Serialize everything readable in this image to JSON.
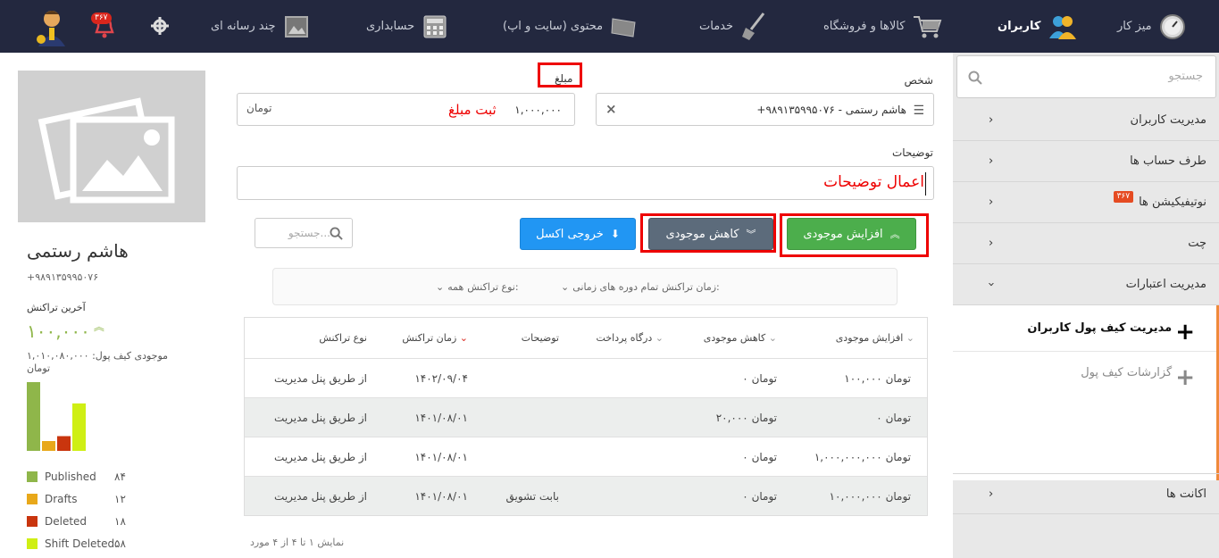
{
  "topbar": {
    "items": [
      {
        "label": "میز کار"
      },
      {
        "label": "کاربران"
      },
      {
        "label": "کالاها و فروشگاه"
      },
      {
        "label": "خدمات"
      },
      {
        "label": "محتوی (سایت و اپ)"
      },
      {
        "label": "حسابداری"
      },
      {
        "label": "چند رسانه ای"
      }
    ],
    "notification_badge": "۳۶۷"
  },
  "sidebar": {
    "search_placeholder": "جستجو",
    "items": [
      {
        "label": "مدیریت کاربران"
      },
      {
        "label": "طرف حساب ها"
      },
      {
        "label": "نوتیفیکیشن ها",
        "badge": "۳۶۷"
      },
      {
        "label": "چت"
      },
      {
        "label": "مدیریت اعتبارات"
      }
    ],
    "subitems": [
      {
        "label": "مدیریت کیف پول کاربران"
      },
      {
        "label": "گزارشات کیف پول"
      }
    ],
    "accounts_label": "اکانت ها"
  },
  "form": {
    "person_label": "شخص",
    "person_value": "+۹۸۹۱۳۵۹۹۵۰۷۶ - هاشم رستمی",
    "amount_label": "مبلغ",
    "amount_value": "۱,۰۰۰,۰۰۰",
    "amount_unit": "تومان",
    "amount_annotation": "ثبت مبلغ",
    "desc_label": "توضیحات",
    "desc_value": "اعمال توضیحات"
  },
  "actions": {
    "increase": "افزایش موجودی",
    "decrease": "کاهش موجودی",
    "excel": "خروجی اکسل",
    "search_placeholder": "جستجو..."
  },
  "filters": {
    "time_label": "زمان تراکنش:",
    "time_value": "تمام دوره های زمانی",
    "type_label": "نوع تراکنش:",
    "type_value": "همه"
  },
  "table": {
    "headers": [
      "افزایش موجودی",
      "کاهش موجودی",
      "درگاه پرداخت",
      "توضیحات",
      "زمان تراکنش",
      "نوع تراکنش"
    ],
    "rows": [
      [
        "۱۰۰,۰۰۰ تومان",
        "۰ تومان",
        "",
        "",
        "۱۴۰۲/۰۹/۰۴",
        "از طریق پنل مدیریت"
      ],
      [
        "۰ تومان",
        "۲۰,۰۰۰ تومان",
        "",
        "",
        "۱۴۰۱/۰۸/۰۱",
        "از طریق پنل مدیریت"
      ],
      [
        "۱,۰۰۰,۰۰۰,۰۰۰ تومان",
        "۰ تومان",
        "",
        "",
        "۱۴۰۱/۰۸/۰۱",
        "از طریق پنل مدیریت"
      ],
      [
        "۱۰,۰۰۰,۰۰۰ تومان",
        "۰ تومان",
        "",
        "بابت تشویق",
        "۱۴۰۱/۰۸/۰۱",
        "از طریق پنل مدیریت"
      ]
    ],
    "footer": "نمایش ۱ تا ۴ از ۴ مورد"
  },
  "profile": {
    "name": "هاشم رستمی",
    "phone": "+۹۸۹۱۳۵۹۹۵۰۷۶",
    "last_tx_label": "آخرین تراکنش",
    "last_tx_value": "۱۰۰,۰۰۰",
    "wallet_label": "موجودی کیف پول: ۱,۰۱۰,۰۸۰,۰۰۰",
    "wallet_unit": "تومان"
  },
  "chart_data": {
    "type": "bar",
    "categories": [
      "Published",
      "Drafts",
      "Deleted",
      "Shift Deleted"
    ],
    "values": [
      84,
      12,
      18,
      58
    ],
    "value_labels": [
      "۸۴",
      "۱۲",
      "۱۸",
      "۵۸"
    ],
    "colors": [
      "#8fb64a",
      "#e8a81a",
      "#c9350e",
      "#cfef14"
    ]
  }
}
